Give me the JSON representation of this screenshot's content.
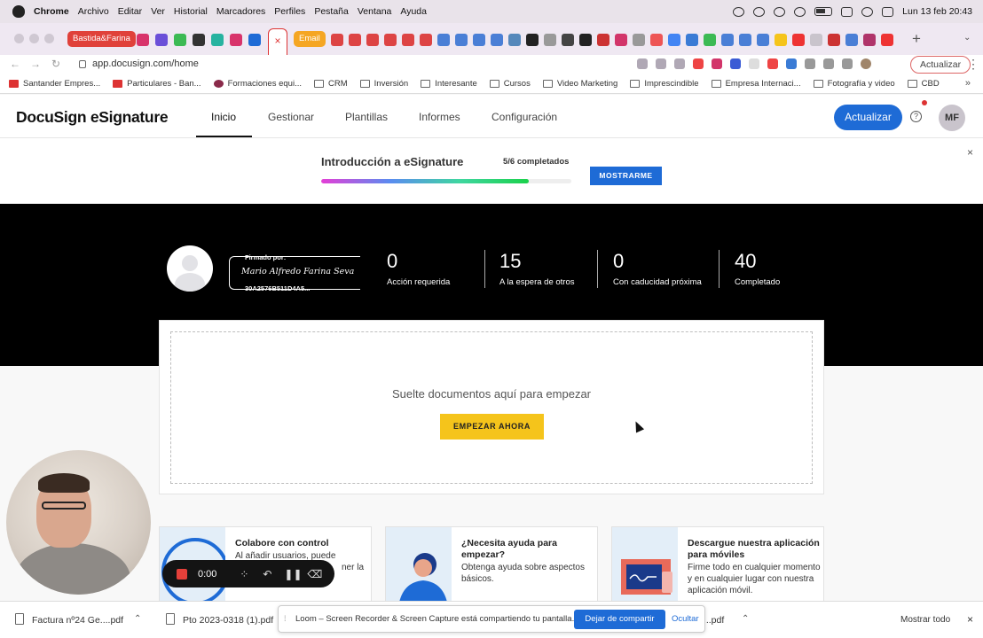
{
  "menubar": {
    "app": "Chrome",
    "items": [
      "Archivo",
      "Editar",
      "Ver",
      "Historial",
      "Marcadores",
      "Perfiles",
      "Pestaña",
      "Ventana",
      "Ayuda"
    ],
    "datetime": "Lun 13 feb 20:43"
  },
  "tabs": {
    "group1": "Bastida&Farina",
    "group2": "Email",
    "group1_color": "#e0413a",
    "group2_color": "#f5a623"
  },
  "address": {
    "url": "app.docusign.com/home",
    "update_label": "Actualizar"
  },
  "bookmarks": [
    "Santander Empres...",
    "Particulares - Ban...",
    "Formaciones equi...",
    "CRM",
    "Inversión",
    "Interesante",
    "Cursos",
    "Video Marketing",
    "Imprescindible",
    "Empresa Internaci...",
    "Fotografía y video",
    "CBD"
  ],
  "docusign": {
    "logo": "DocuSign eSignature",
    "nav": [
      "Inicio",
      "Gestionar",
      "Plantillas",
      "Informes",
      "Configuración"
    ],
    "upgrade_label": "Actualizar",
    "help": "?",
    "avatar_initials": "MF",
    "brand_color": "#1e6bd6"
  },
  "intro": {
    "title": "Introducción a eSignature",
    "count": "5/6 completados",
    "progress": 0.83,
    "button": "MOSTRARME",
    "close": "×"
  },
  "signature": {
    "label": "Firmado por:",
    "name": "Mario Alfredo Farina Seva",
    "code": "30A2576B511D4A5..."
  },
  "stats": [
    {
      "value": "0",
      "label": "Acción requerida"
    },
    {
      "value": "15",
      "label": "A la espera de otros"
    },
    {
      "value": "0",
      "label": "Con caducidad próxima"
    },
    {
      "value": "40",
      "label": "Completado"
    }
  ],
  "dropzone": {
    "text": "Suelte documentos aquí para empezar",
    "button": "EMPEZAR AHORA",
    "button_color": "#f5c41b"
  },
  "cards": [
    {
      "title": "Colabore con control",
      "body1": "Al añadir usuarios, puede",
      "body2": "ner la"
    },
    {
      "title": "¿Necesita ayuda para empezar?",
      "body": "Obtenga ayuda sobre aspectos básicos."
    },
    {
      "title": "Descargue nuestra aplicación para móviles",
      "body": "Firme todo en cualquier momento y en cualquier lugar con nuestra aplicación móvil."
    }
  ],
  "recorder": {
    "time": "0:00"
  },
  "downloads": {
    "items": [
      "Factura nº24 Ge....pdf",
      "Pto 2023-0318 (1).pdf",
      "....pdf"
    ],
    "show_all": "Mostrar todo"
  },
  "loom": {
    "message": "Loom – Screen Recorder & Screen Capture está compartiendo tu pantalla.",
    "stop": "Dejar de compartir",
    "hide": "Ocultar"
  }
}
